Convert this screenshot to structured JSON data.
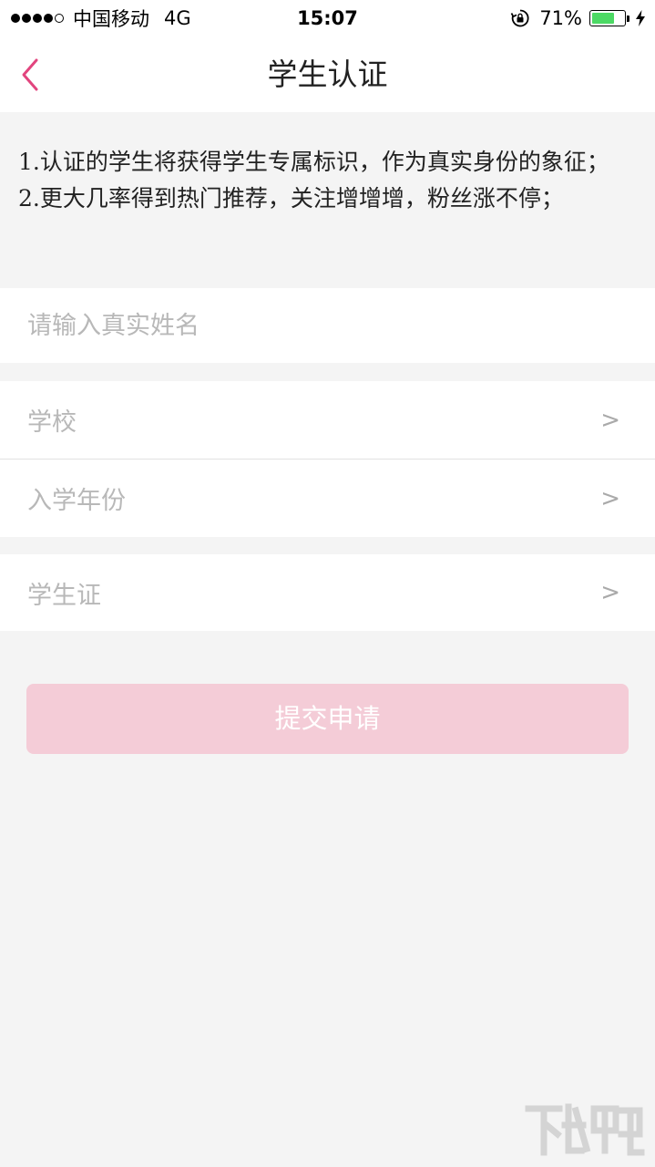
{
  "status_bar": {
    "carrier": "中国移动",
    "network": "4G",
    "time": "15:07",
    "battery_percent": "71%",
    "battery_level": 0.71
  },
  "nav": {
    "back_icon": "chevron-left-icon",
    "title": "学生认证"
  },
  "info": {
    "line1": "1.认证的学生将获得学生专属标识，作为真实身份的象征；",
    "line2": "2.更大几率得到热门推荐，关注增增增，粉丝涨不停；"
  },
  "form": {
    "name_placeholder": "请输入真实姓名",
    "school_label": "学校",
    "year_label": "入学年份",
    "student_card_label": "学生证",
    "arrow": ">"
  },
  "submit": {
    "label": "提交申请"
  },
  "colors": {
    "accent": "#e2457e",
    "submit_bg": "#f4ccd7",
    "battery": "#4cd964",
    "page_bg": "#f4f4f4"
  }
}
